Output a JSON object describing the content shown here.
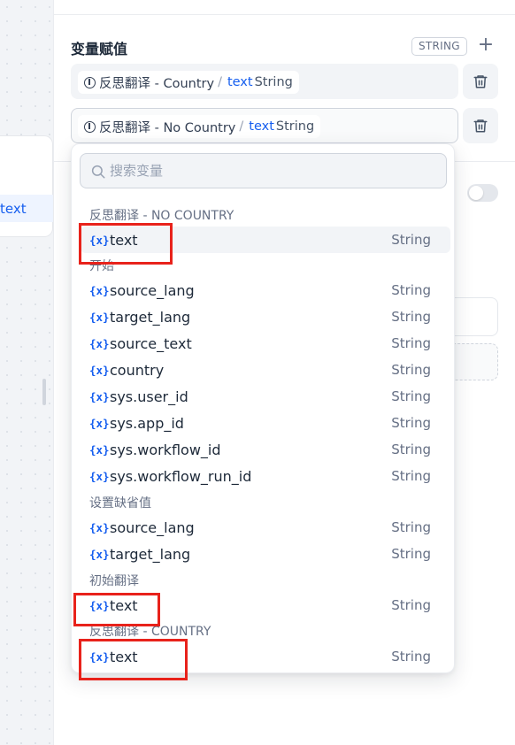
{
  "canvas": {
    "node_text": "text"
  },
  "panel": {
    "section_title": "变量赋值",
    "type_badge": "STRING",
    "add_icon": "plus-icon",
    "assigned_vars": [
      {
        "node": "反思翻译 - Country",
        "sep": "/",
        "var": "text",
        "type": "String"
      },
      {
        "node": "反思翻译 - No Country",
        "sep": "/",
        "var": "text",
        "type": "String"
      }
    ],
    "delete_icon": "trash-icon"
  },
  "dropdown": {
    "search_placeholder": "搜索变量",
    "var_icon": "{x}",
    "groups": [
      {
        "title": "反思翻译 - NO COUNTRY",
        "items": [
          {
            "name": "text",
            "type": "String"
          }
        ]
      },
      {
        "title": "开始",
        "items": [
          {
            "name": "source_lang",
            "type": "String"
          },
          {
            "name": "target_lang",
            "type": "String"
          },
          {
            "name": "source_text",
            "type": "String"
          },
          {
            "name": "country",
            "type": "String"
          },
          {
            "name": "sys.user_id",
            "type": "String"
          },
          {
            "name": "sys.app_id",
            "type": "String"
          },
          {
            "name": "sys.workflow_id",
            "type": "String"
          },
          {
            "name": "sys.workflow_run_id",
            "type": "String"
          }
        ]
      },
      {
        "title": "设置缺省值",
        "items": [
          {
            "name": "source_lang",
            "type": "String"
          },
          {
            "name": "target_lang",
            "type": "String"
          }
        ]
      },
      {
        "title": "初始翻译",
        "items": [
          {
            "name": "text",
            "type": "String"
          }
        ]
      },
      {
        "title": "反思翻译 - COUNTRY",
        "items": [
          {
            "name": "text",
            "type": "String"
          }
        ]
      }
    ]
  },
  "colors": {
    "accent": "#155eef",
    "highlight": "#e8221b"
  }
}
